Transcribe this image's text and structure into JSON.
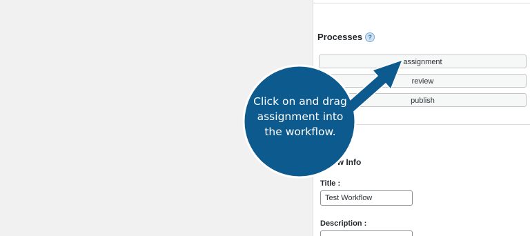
{
  "processes": {
    "heading": "Processes",
    "help_icon_glyph": "?",
    "items": [
      {
        "label": "assignment"
      },
      {
        "label": "review"
      },
      {
        "label": "publish"
      }
    ]
  },
  "workflow_info": {
    "heading": "low Info",
    "title_label": "Title :",
    "title_value": "Test Workflow",
    "description_label": "Description :"
  },
  "callout": {
    "text": "Click on and drag assignment into the workflow.",
    "color": "#0d5a8f",
    "icon": "arrow-right-icon"
  }
}
